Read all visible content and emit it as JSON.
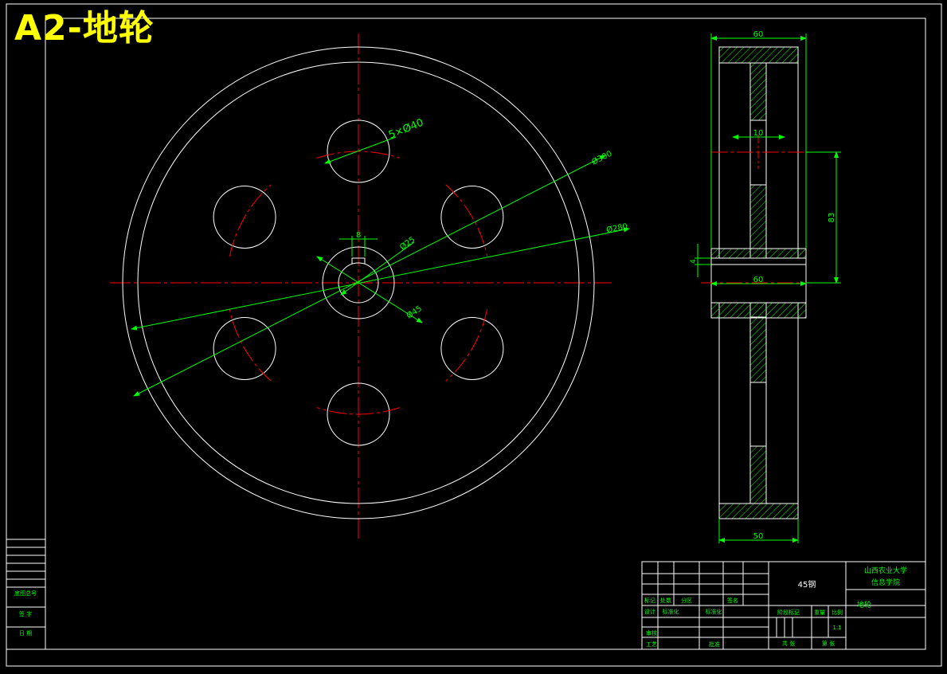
{
  "title": "A2-地轮",
  "colors": {
    "background": "#000000",
    "outline": "#ffffff",
    "centerline": "#ff0000",
    "dimension": "#00ff00",
    "hatch": "#00ff00",
    "title_text": "#ffff00"
  },
  "front_view": {
    "dims": {
      "holes": "5×Ø40",
      "outer_dia": "Ø300",
      "rim_dia": "Ø280",
      "bore_dia": "Ø25",
      "hub_dia": "Ø45",
      "keyway": "8"
    }
  },
  "section_view": {
    "dims": {
      "overall_width": "60",
      "web_thickness": "10",
      "radial": "83",
      "step": "4",
      "hub_width": "60",
      "rim_width": "50"
    }
  },
  "left_strip": {
    "row1": "底图总号",
    "row2": "签  字",
    "row3": "日  期"
  },
  "title_block": {
    "material": "45钢",
    "school_line1": "山西农业大学",
    "school_line2": "信息学院",
    "part_name": "地轮",
    "labels": {
      "mark": "标记",
      "count": "处数",
      "zone": "分区",
      "sign": "签名",
      "design": "设计",
      "standardize": "标准化",
      "stage_mark": "阶段标记",
      "weight": "重量",
      "scale": "比例",
      "review": "审核",
      "process": "工艺",
      "approve": "批准",
      "sheets_total": "共 张",
      "sheet_no": "第 张",
      "scale_value": "1:1"
    }
  }
}
